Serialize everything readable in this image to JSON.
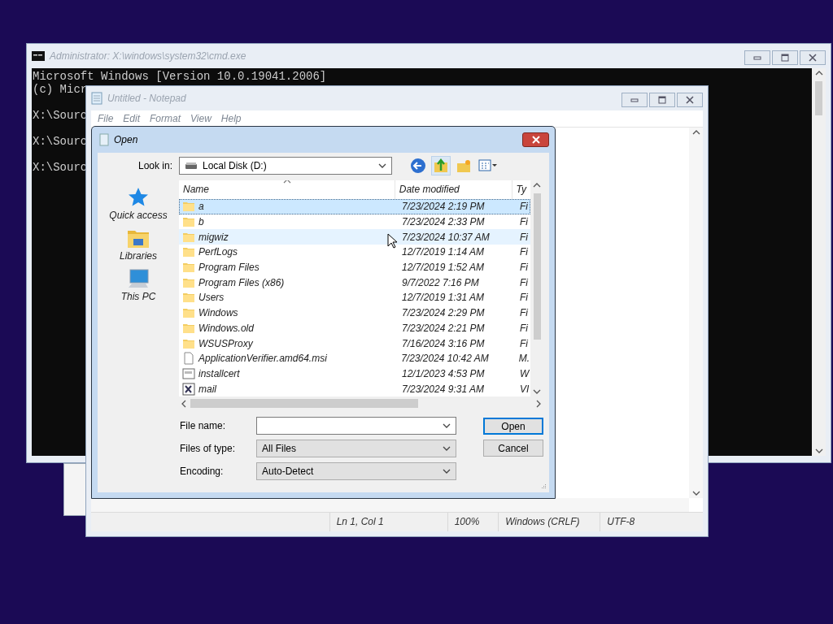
{
  "cmd_window": {
    "title": "Administrator: X:\\windows\\system32\\cmd.exe",
    "lines": [
      {
        "text": "Microsoft Windows [Version 10.0.19041.2006]",
        "kind": "output"
      },
      {
        "text": "(c) Micr",
        "kind": "output"
      },
      {
        "text": "X:\\Sourc",
        "kind": "prompt"
      },
      {
        "text": "X:\\Sourc",
        "kind": "prompt"
      },
      {
        "text": "X:\\Sourc",
        "kind": "prompt"
      }
    ]
  },
  "notepad": {
    "title": "Untitled - Notepad",
    "menu": [
      "File",
      "Edit",
      "Format",
      "View",
      "Help"
    ],
    "status_bar": [
      "Ln 1, Col 1",
      "100%",
      "Windows (CRLF)",
      "UTF-8"
    ]
  },
  "open_dialog": {
    "title": "Open",
    "look_in": {
      "label": "Look in:",
      "value": "Local Disk (D:)"
    },
    "places": [
      {
        "label": "Quick access",
        "kind": "star"
      },
      {
        "label": "Libraries",
        "kind": "libraries"
      },
      {
        "label": "This PC",
        "kind": "pc"
      }
    ],
    "columns": [
      "Name",
      "Date modified",
      "Ty"
    ],
    "rows": [
      {
        "name": "a",
        "date": "7/23/2024 2:19 PM",
        "type": "Fi",
        "kind": "folder",
        "selected": true,
        "hovered": false
      },
      {
        "name": "b",
        "date": "7/23/2024 2:33 PM",
        "type": "Fi",
        "kind": "folder",
        "selected": false,
        "hovered": false
      },
      {
        "name": "migwiz",
        "date": "7/23/2024 10:37 AM",
        "type": "Fi",
        "kind": "folder",
        "selected": false,
        "hovered": true
      },
      {
        "name": "PerfLogs",
        "date": "12/7/2019 1:14 AM",
        "type": "Fi",
        "kind": "folder",
        "selected": false,
        "hovered": false
      },
      {
        "name": "Program Files",
        "date": "12/7/2019 1:52 AM",
        "type": "Fi",
        "kind": "folder",
        "selected": false,
        "hovered": false
      },
      {
        "name": "Program Files (x86)",
        "date": "9/7/2022 7:16 PM",
        "type": "Fi",
        "kind": "folder",
        "selected": false,
        "hovered": false
      },
      {
        "name": "Users",
        "date": "12/7/2019 1:31 AM",
        "type": "Fi",
        "kind": "folder",
        "selected": false,
        "hovered": false
      },
      {
        "name": "Windows",
        "date": "7/23/2024 2:29 PM",
        "type": "Fi",
        "kind": "folder",
        "selected": false,
        "hovered": false
      },
      {
        "name": "Windows.old",
        "date": "7/23/2024 2:21 PM",
        "type": "Fi",
        "kind": "folder",
        "selected": false,
        "hovered": false
      },
      {
        "name": "WSUSProxy",
        "date": "7/16/2024 3:16 PM",
        "type": "Fi",
        "kind": "folder",
        "selected": false,
        "hovered": false
      },
      {
        "name": "ApplicationVerifier.amd64.msi",
        "date": "7/23/2024 10:42 AM",
        "type": "M.",
        "kind": "file",
        "selected": false,
        "hovered": false
      },
      {
        "name": "installcert",
        "date": "12/1/2023 4:53 PM",
        "type": "W",
        "kind": "cert",
        "selected": false,
        "hovered": false
      },
      {
        "name": "mail",
        "date": "7/23/2024 9:31 AM",
        "type": "VI",
        "kind": "script",
        "selected": false,
        "hovered": false
      }
    ],
    "fields": [
      {
        "label": "File name:",
        "kind": "editable"
      },
      {
        "label": "Files of type:",
        "value": "All Files",
        "kind": "list"
      },
      {
        "label": "Encoding:",
        "value": "Auto-Detect",
        "kind": "list"
      }
    ],
    "buttons": [
      {
        "label": "Open",
        "default": true
      },
      {
        "label": "Cancel",
        "default": false
      }
    ]
  }
}
